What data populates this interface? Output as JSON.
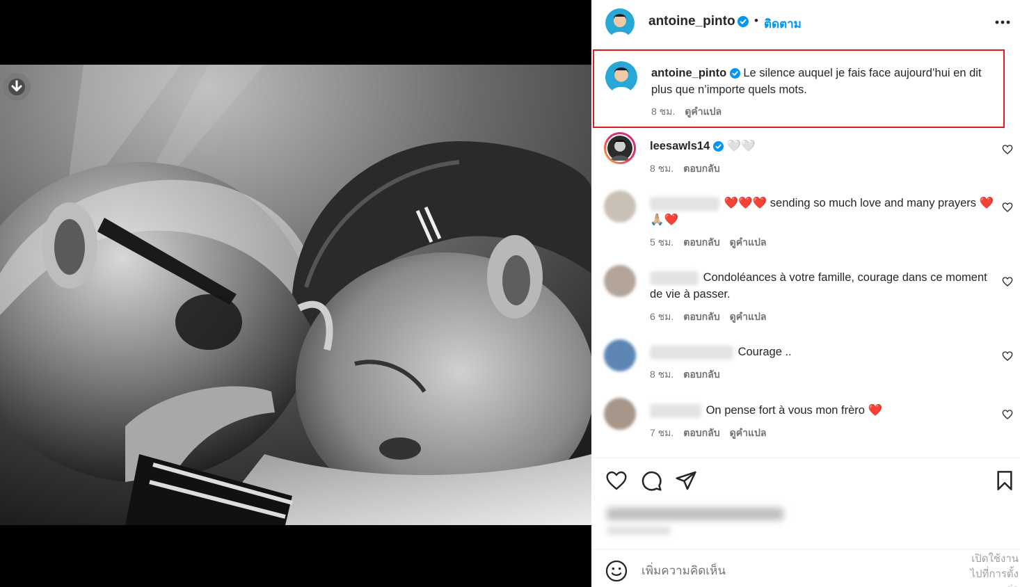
{
  "post": {
    "username": "antoine_pinto",
    "separator": "•",
    "follow_label": "ติดตาม"
  },
  "caption": {
    "username": "antoine_pinto",
    "text": "Le silence auquel je fais face aujourd’hui en dit plus que n’importe quels mots.",
    "time": "8 ชม.",
    "translate": "ดูคำแปล"
  },
  "comments": [
    {
      "username": "leesawls14",
      "text": "🤍🤍",
      "time": "8 ชม.",
      "reply": "ตอบกลับ",
      "translate": ""
    },
    {
      "username": "",
      "text": "❤️❤️❤️ sending so much love and many prayers ❤️🙏🏼❤️",
      "time": "5 ชม.",
      "reply": "ตอบกลับ",
      "translate": "ดูคำแปล"
    },
    {
      "username": "",
      "text": "Condoléances à votre famille, courage dans ce moment de vie à passer.",
      "time": "6 ชม.",
      "reply": "ตอบกลับ",
      "translate": "ดูคำแปล"
    },
    {
      "username": "",
      "text": "Courage ..",
      "time": "8 ชม.",
      "reply": "ตอบกลับ",
      "translate": ""
    },
    {
      "username": "",
      "text": "On pense fort à vous mon frèro ❤️",
      "time": "7 ชม.",
      "reply": "ตอบกลับ",
      "translate": "ดูคำแปล"
    }
  ],
  "composer": {
    "placeholder": "เพิ่มความคิดเห็น"
  },
  "watermark": {
    "line1": "เปิดใช้งาน",
    "line2": "ไปที่การตั้งค่า"
  },
  "colors": {
    "accent": "#0095f6",
    "verified": "#0095f6",
    "highlight_border": "#e11a1a",
    "heart": "#e0232b"
  },
  "icons": {
    "download": "arrow-down-circle-icon",
    "more": "more-horizontal-icon",
    "like": "heart-icon",
    "comment": "comment-bubble-icon",
    "share": "paper-plane-icon",
    "save": "bookmark-icon",
    "emoji": "emoji-smile-icon"
  }
}
